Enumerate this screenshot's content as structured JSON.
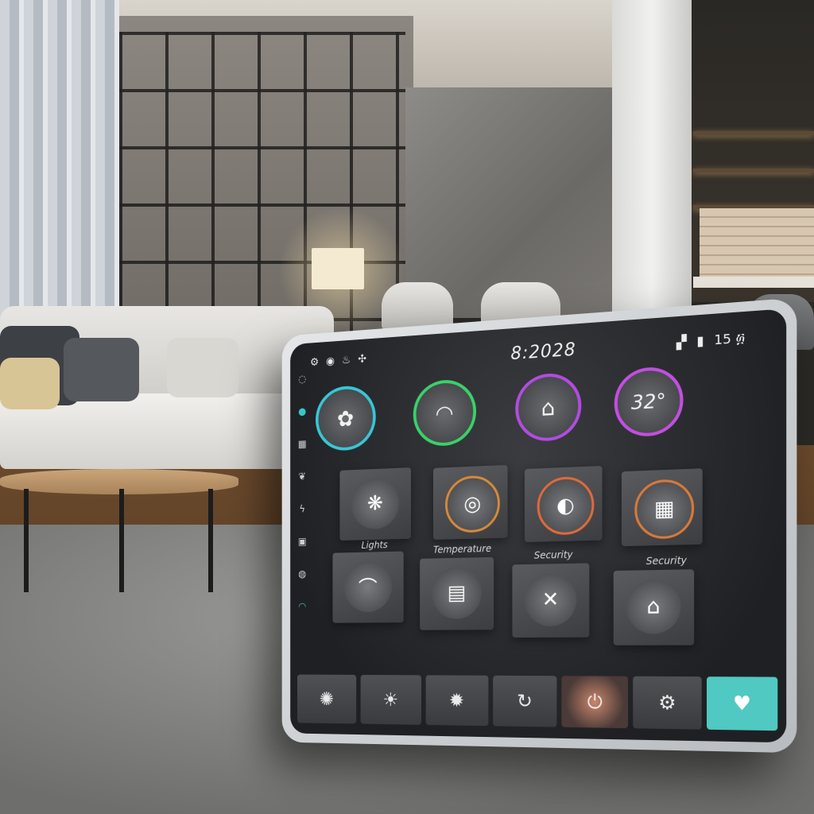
{
  "status_bar": {
    "clock": "8:2028",
    "right_text": "15 ፴",
    "icons_left": [
      "settings-icon",
      "eco-icon",
      "drop-icon",
      "fan-icon"
    ]
  },
  "rings": [
    {
      "icon": "fan-icon",
      "glyph": "✿",
      "color": "#38c6d6"
    },
    {
      "icon": "dome-light-icon",
      "glyph": "◠",
      "color": "#3ad16a"
    },
    {
      "icon": "home-icon",
      "glyph": "⌂",
      "color": "#b04de0"
    },
    {
      "icon": "thermostat-icon",
      "value": "32°",
      "color": "#c24fe0"
    }
  ],
  "tiles_row1": [
    {
      "icon": "sensor-icon",
      "glyph": "❋"
    },
    {
      "icon": "dial-icon",
      "glyph": "◎"
    },
    {
      "icon": "camera-icon",
      "glyph": "◐"
    },
    {
      "icon": "window-icon",
      "glyph": "▦"
    }
  ],
  "tile_labels": {
    "lights": "Lights",
    "temperature": "Temperature",
    "security_1": "Security",
    "security_2": "Security"
  },
  "tiles_row2": [
    {
      "icon": "arch-light-icon",
      "glyph": "⌒"
    },
    {
      "icon": "thermo-panel-icon",
      "glyph": "▤"
    },
    {
      "icon": "tools-icon",
      "glyph": "✕"
    },
    {
      "icon": "house-lock-icon",
      "glyph": "⌂"
    }
  ],
  "dock": [
    {
      "icon": "gear-icon",
      "glyph": "✺"
    },
    {
      "icon": "sun-icon",
      "glyph": "☀"
    },
    {
      "icon": "brightness-icon",
      "glyph": "✹"
    },
    {
      "icon": "refresh-icon",
      "glyph": "↻"
    },
    {
      "icon": "power-icon",
      "glyph": "⏻"
    },
    {
      "icon": "settings-icon",
      "glyph": "⚙"
    },
    {
      "icon": "heart-icon",
      "glyph": "♥"
    }
  ],
  "side_rail": [
    "bulb-icon",
    "dot-icon",
    "grid-icon",
    "fan-icon",
    "leaf-icon",
    "bolt-icon",
    "lock-icon",
    "info-icon",
    "wifi-icon"
  ],
  "colors": {
    "accent_teal": "#4fc9c1",
    "ring_green": "#3ad16a",
    "ring_purple": "#b04de0"
  }
}
